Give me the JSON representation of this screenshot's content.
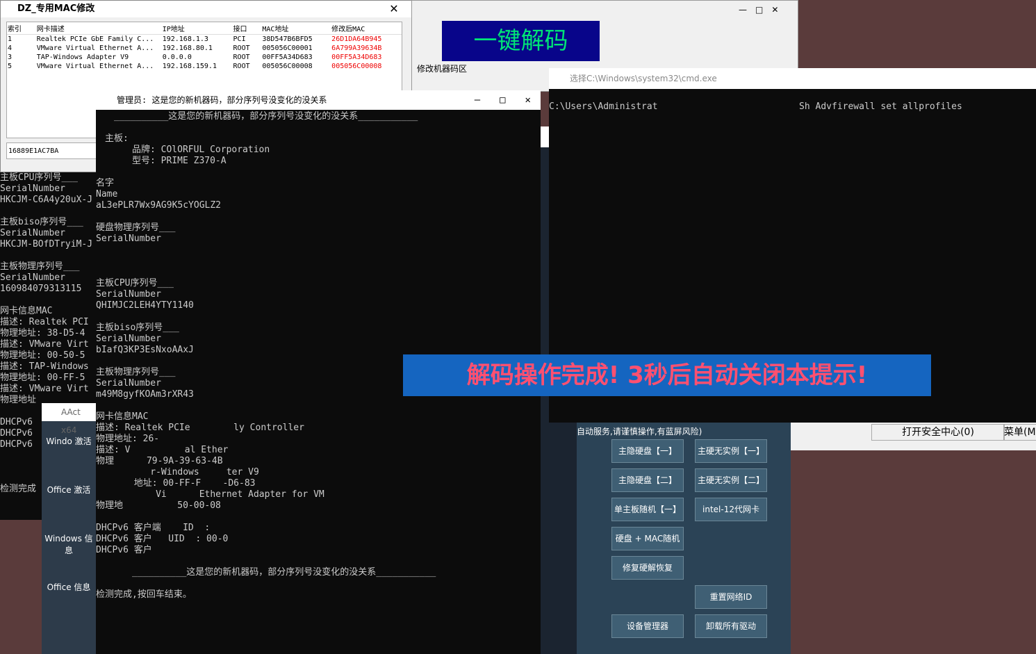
{
  "mac_window": {
    "title": "DZ_专用MAC修改",
    "headers": [
      "索引",
      "网卡描述",
      "IP地址",
      "接口",
      "MAC地址",
      "修改后MAC"
    ],
    "rows": [
      [
        "1",
        "Realtek PCIe GbE Family C...",
        "192.168.1.3",
        "PCI",
        "38D547B6BFD5",
        "26D1DA64B945"
      ],
      [
        "4",
        "VMware Virtual Ethernet A...",
        "192.168.80.1",
        "ROOT",
        "005056C00001",
        "6A799A39634B"
      ],
      [
        "3",
        "TAP-Windows Adapter V9",
        "0.0.0.0",
        "ROOT",
        "00FF5A34D683",
        "00FF5A34D683"
      ],
      [
        "5",
        "VMware Virtual Ethernet A...",
        "192.168.159.1",
        "ROOT",
        "005056C00008",
        "005056C00008"
      ]
    ],
    "input_value": "16889E1AC7BA"
  },
  "decode_button": "一键解码",
  "modify_label": "修改机器码区",
  "console": {
    "title": "管理员: 这是您的新机器码，部分序列号没变化的没关系",
    "lines": [
      "　　__________这是您的新机器码，部分序列号没变化的没关系___________",
      "",
      "　主板:",
      "　　　　品牌: COlORFUL Corporation",
      "　　　　型号: PRIME Z370-A",
      "",
      "名字",
      "Name",
      "aL3ePLR7Wx9AG9K5cYOGLZ2",
      "",
      "硬盘物理序列号___",
      "SerialNumber",
      "",
      "",
      "",
      "主板CPU序列号___",
      "SerialNumber",
      "QHIMJC2LEH4YTY1140",
      "",
      "主板biso序列号___",
      "SerialNumber",
      "bIafQ3KP3EsNxoAAxJ",
      "",
      "主板物理序列号___",
      "SerialNumber",
      "m49M8gyfKOAm3rXR43",
      "",
      "网卡信息MAC",
      "描述: Realtek PCIe        ly Controller",
      "物理地址: 26-",
      "描述: V          al Ether",
      "物理      79-9A-39-63-4B",
      "          r-Windows     ter V9",
      "       地址: 00-FF-F    -D6-83",
      "           Vi      Ethernet Adapter for VM",
      "物理地          50-00-08",
      "",
      "DHCPv6 客户端    ID  :",
      "DHCPv6 客户   UID  : 00-0",
      "DHCPv6 客户",
      "",
      "　　　　__________这是您的新机器码，部分序列号没变化的没关系___________",
      "",
      "检测完成,按回车结束。"
    ]
  },
  "left_lines": [
    "主板CPU序列号___",
    "SerialNumber",
    "HKCJM-C6A4y20uX-J",
    "",
    "主板biso序列号___",
    "SerialNumber",
    "HKCJM-BOfDTryiM-J",
    "",
    "主板物理序列号___",
    "SerialNumber",
    "160984079313115",
    "",
    "网卡信息MAC",
    "描述: Realtek PCI",
    "物理地址: 38-D5-4",
    "描述: VMware Virt",
    "物理地址: 00-50-5",
    "描述: TAP-Windows",
    "物理地址: 00-FF-5",
    "描述: VMware Virt",
    "物理地址",
    "",
    "DHCPv6",
    "DHCPv6",
    "DHCPv6",
    "",
    "",
    "",
    "检测完成"
  ],
  "cmd": {
    "title": "选择C:\\Windows\\system32\\cmd.exe",
    "line": "C:\\Users\\Administrat                          Sh Advfirewall set allprofiles"
  },
  "banner": "解码操作完成! 3秒后自动关闭本提示!",
  "tool": {
    "warning": "自动服务,请谨慎操作,有蓝屏风险)",
    "buttons": [
      "主隐硬盘【一】",
      "主硬无实例【一】",
      "主隐硬盘【二】",
      "主硬无实例【二】",
      "单主板随机【一】",
      "intel-12代网卡",
      "硬盘 + MAC随机",
      "修复硬解恢复",
      "重置网络ID",
      "设备管理器",
      "卸载所有驱动"
    ],
    "security": "打开安全中心(0)",
    "menu": "菜单(M"
  },
  "aact": {
    "title": "AAct x64",
    "items": [
      "Windo 激活",
      "Office 激活",
      "Windows 信息",
      "Office 信息"
    ]
  }
}
